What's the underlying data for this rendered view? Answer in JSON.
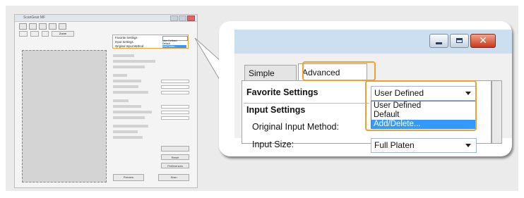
{
  "thumbnail": {
    "title": "ScanGear MF",
    "tool_button": "Zoom",
    "side": {
      "favorite_label": "Favorite Settings",
      "favorite_value": "User Defined",
      "input_label": "Input Settings",
      "method_label": "Original Input Method",
      "options": [
        "User Defined",
        "Default",
        "Add/Delete..."
      ],
      "buttons": [
        "Reset",
        "Preferences",
        "Preview",
        "Scan"
      ]
    }
  },
  "window": {
    "minimize_icon": "minimize-icon",
    "maximize_icon": "maximize-icon",
    "close_icon": "close-icon",
    "close_glyph": "✕",
    "tabs": [
      {
        "label": "Simple Mode",
        "active": false
      },
      {
        "label": "Advanced Mode",
        "active": true
      }
    ],
    "favorite_settings_label": "Favorite Settings",
    "favorite_settings_value": "User Defined",
    "dropdown_options": [
      {
        "label": "User Defined",
        "selected": false
      },
      {
        "label": "Default",
        "selected": false
      },
      {
        "label": "Add/Delete...",
        "selected": true
      }
    ],
    "input_settings_label": "Input Settings",
    "original_input_method_label": "Original Input Method:",
    "input_size_label": "Input Size:",
    "input_size_value": "Full Platen"
  },
  "colors": {
    "highlight": "#f0a030",
    "titlebar": "#ccdff1",
    "selection": "#3399ff"
  }
}
